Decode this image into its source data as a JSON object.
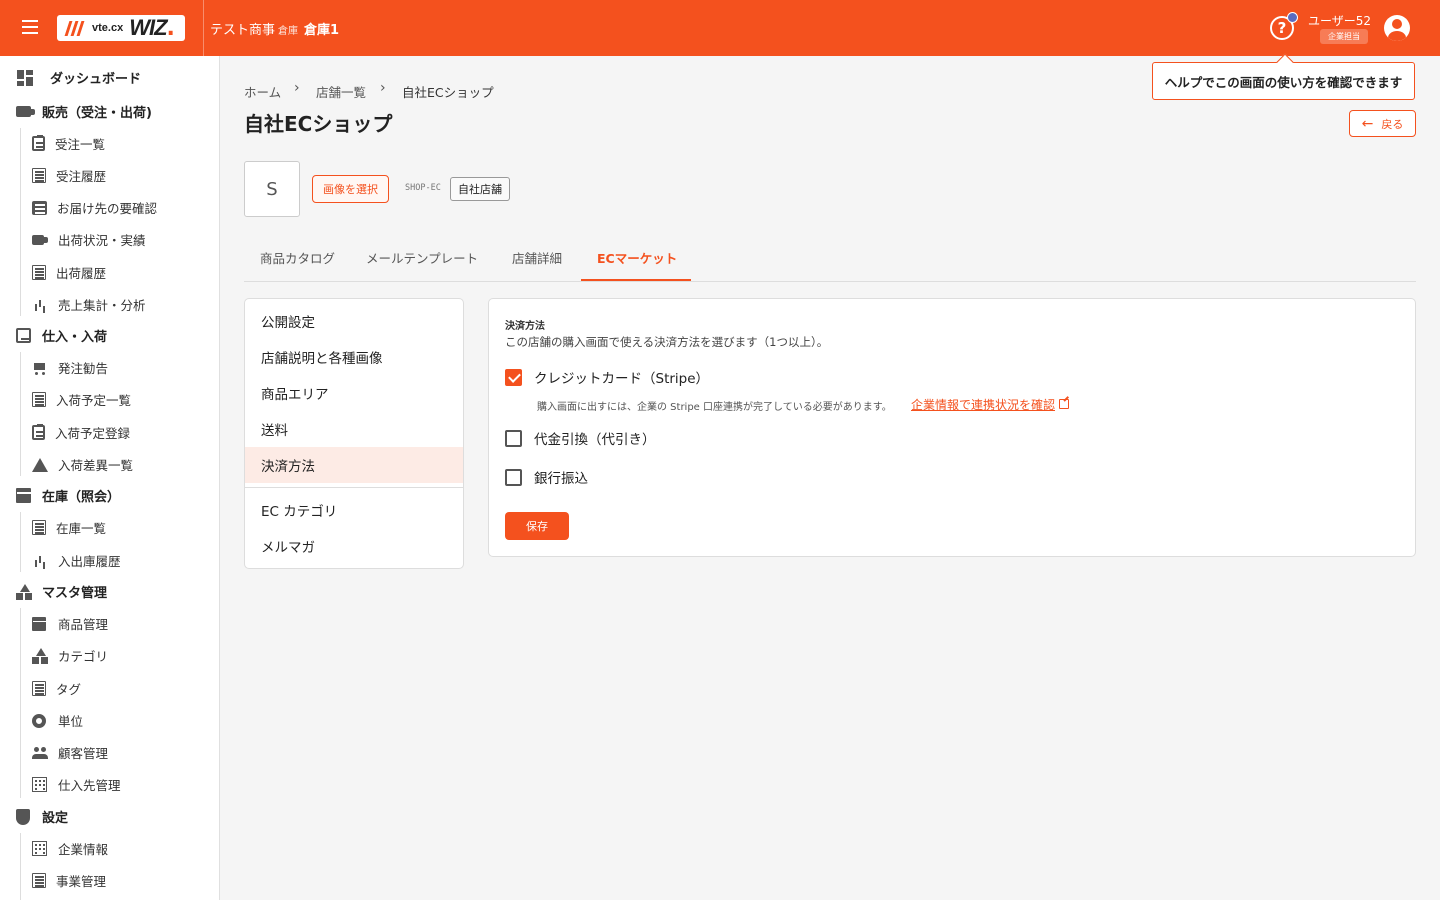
{
  "header": {
    "logo_text_small": "vte.cx",
    "logo_text_large": "WIZ",
    "company": "テスト商事",
    "warehouse_label": "倉庫",
    "warehouse": "倉庫1",
    "user_name": "ユーザー52",
    "user_role": "企業担当",
    "help_glyph": "?",
    "brand_color": "#f4511e"
  },
  "tooltip": {
    "text": "ヘルプでこの画面の使い方を確認できます"
  },
  "sidebar": {
    "dashboard": "ダッシュボード",
    "sales": {
      "label": "販売（受注・出荷)",
      "items": [
        "受注一覧",
        "受注履歴",
        "お届け先の要確認",
        "出荷状況・実績",
        "出荷履歴",
        "売上集計・分析"
      ]
    },
    "purchase": {
      "label": "仕入・入荷",
      "items": [
        "発注勧告",
        "入荷予定一覧",
        "入荷予定登録",
        "入荷差異一覧"
      ]
    },
    "stock": {
      "label": "在庫（照会）",
      "items": [
        "在庫一覧",
        "入出庫履歴"
      ]
    },
    "master": {
      "label": "マスタ管理",
      "items": [
        "商品管理",
        "カテゴリ",
        "タグ",
        "単位",
        "顧客管理",
        "仕入先管理"
      ]
    },
    "settings": {
      "label": "設定",
      "items": [
        "企業情報",
        "事業管理"
      ]
    }
  },
  "breadcrumb": [
    "ホーム",
    "店舗一覧",
    "自社ECショップ"
  ],
  "breadcrumb_sep": "›",
  "page": {
    "title": "自社ECショップ",
    "back_label": "戻る",
    "back_arrow": "←",
    "shop_initial": "S",
    "select_image_label": "画像を選択",
    "shop_code": "SHOP-EC",
    "shop_type": "自社店舗"
  },
  "tabs": [
    "商品カタログ",
    "メールテンプレート",
    "店舗詳細",
    "ECマーケット"
  ],
  "active_tab": "ECマーケット",
  "side_menu": [
    "公開設定",
    "店舗説明と各種画像",
    "商品エリア",
    "送料",
    "決済方法",
    "EC カテゴリ",
    "メルマガ"
  ],
  "active_side_menu": "決済方法",
  "payment": {
    "section_label": "決済方法",
    "description": "この店舗の購入画面で使える決済方法を選びます（1つ以上）。",
    "options": [
      {
        "label": "クレジットカード（Stripe）",
        "checked": true
      },
      {
        "label": "代金引換（代引き）",
        "checked": false
      },
      {
        "label": "銀行振込",
        "checked": false
      }
    ],
    "stripe_note": "購入画面に出すには、企業の Stripe 口座連携が完了している必要があります。",
    "stripe_link": "企業情報で連携状況を確認",
    "save_label": "保存"
  }
}
